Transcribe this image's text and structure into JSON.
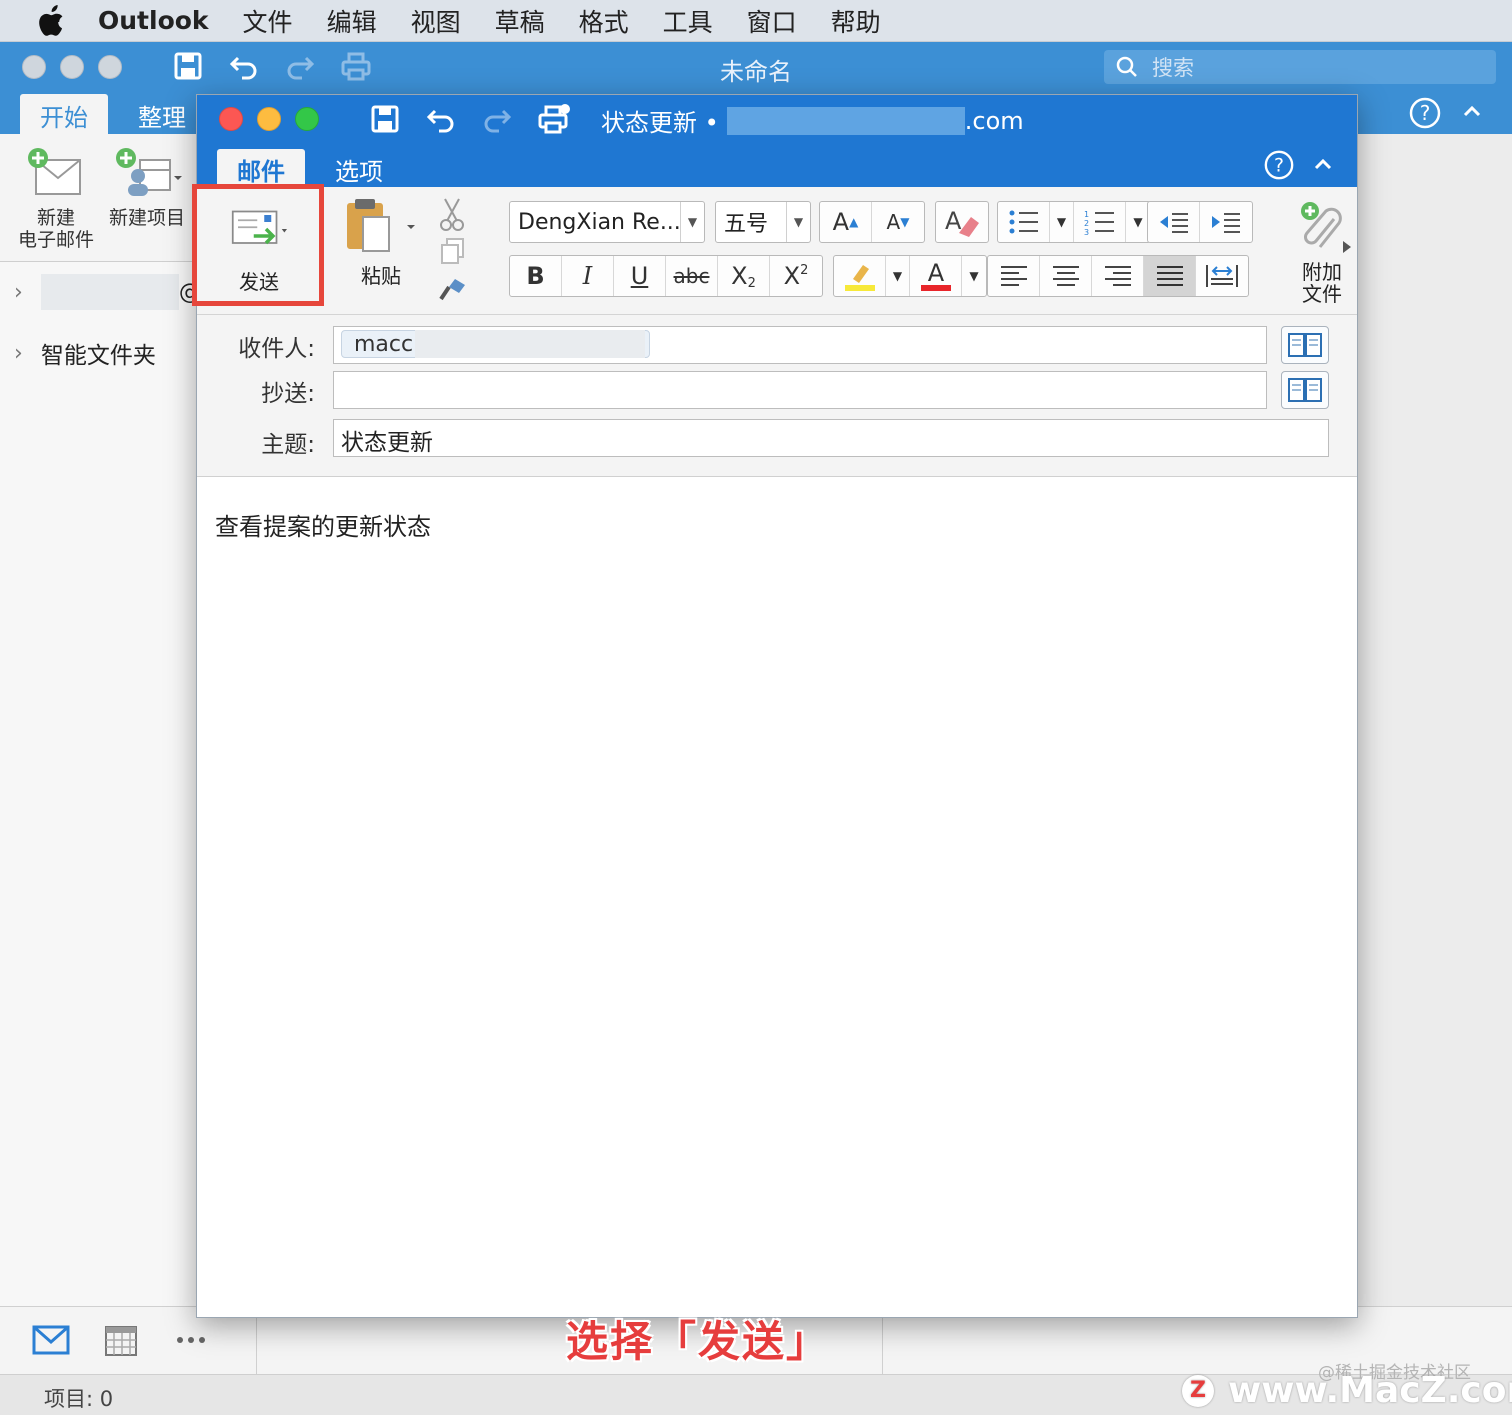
{
  "menubar": {
    "app": "Outlook",
    "items": [
      "文件",
      "编辑",
      "视图",
      "草稿",
      "格式",
      "工具",
      "窗口",
      "帮助"
    ]
  },
  "main_window": {
    "title": "未命名",
    "search_placeholder": "搜索",
    "tabs": [
      "开始",
      "整理"
    ],
    "ribbon": {
      "new_email_line1": "新建",
      "new_email_line2": "电子邮件",
      "new_item": "新建项目"
    },
    "sidebar": {
      "account_suffix": "@",
      "smart_folders": "智能文件夹"
    },
    "status": "项目: 0"
  },
  "compose": {
    "title_prefix": "状态更新 •",
    "title_suffix": ".com",
    "tabs": [
      "邮件",
      "选项"
    ],
    "send_label": "发送",
    "paste_label": "粘贴",
    "font_name": "DengXian Re...",
    "font_size": "五号",
    "attach_line1": "附加",
    "attach_line2": "文件",
    "to_label": "收件人:",
    "to_value": "macc",
    "cc_label": "抄送:",
    "subject_label": "主题:",
    "subject_value": "状态更新",
    "body": "查看提案的更新状态"
  },
  "overlay": {
    "caption": "选择「发送」",
    "watermark_small": "@稀土掘金技术社区",
    "watermark_big": "www.MacZ.com",
    "watermark_logo": "Z"
  },
  "colors": {
    "main_blue": "#3c8fd4",
    "compose_blue": "#1f77d2",
    "highlight_red": "#e6463b"
  }
}
